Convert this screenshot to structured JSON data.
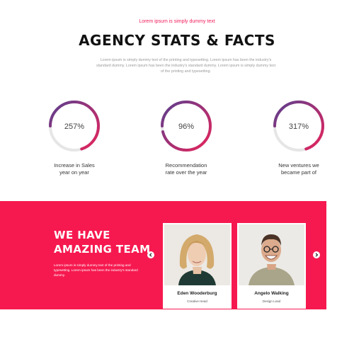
{
  "header": {
    "eyebrow": "Lorem ipsum is simply dummy text",
    "title": "AGENCY STATS & FACTS",
    "intro": "Lorem ipsum is simply dummy text of the printing and typesetting. Lorem ipsum has been the industry's standard dummy. Lorem ipsum has been the industry's standard dummy. Lorem ipsum is simply dummy text of the printing and typesetting."
  },
  "stats": [
    {
      "value": "257%",
      "progress": 0.7,
      "label_line1": "Increase in Sales",
      "label_line2": "year on year"
    },
    {
      "value": "96%",
      "progress": 0.96,
      "label_line1": "Recommendation",
      "label_line2": "rate over the year"
    },
    {
      "value": "317%",
      "progress": 0.7,
      "label_line1": "New ventures we",
      "label_line2": "became part of"
    }
  ],
  "team": {
    "heading_line1": "WE HAVE",
    "heading_line2": "AMAZING TEAM",
    "description": "Lorem ipsum is simply dummy text of the printing and typesetting. Lorem ipsum has been the industry's standard dummy.",
    "members": [
      {
        "name": "Eden Wooderburg",
        "role": "Creative Head"
      },
      {
        "name": "Angelo Walking",
        "role": "Design Lead"
      }
    ]
  },
  "colors": {
    "accent": "#f01c5a",
    "team_bg": "#f6194f",
    "ring_start": "#e8245c",
    "ring_end": "#5b3f8f",
    "ring_track": "#e6e6e6"
  },
  "icons": {
    "prev": "chevron-left-icon",
    "next": "chevron-right-icon"
  }
}
